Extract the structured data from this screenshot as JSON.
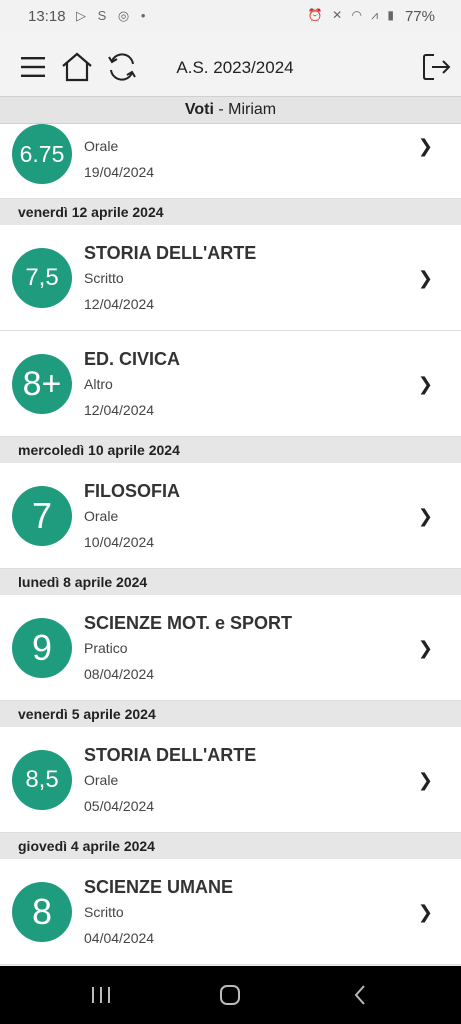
{
  "status_bar": {
    "time": "13:18",
    "battery": "77%",
    "left_icons": [
      "media-icon",
      "s-app-icon",
      "instagram-icon",
      "dot-icon"
    ],
    "right_icons": [
      "alarm-icon",
      "mute-icon",
      "wifi-icon",
      "signal-icon"
    ]
  },
  "top_bar": {
    "title": "A.S. 2023/2024"
  },
  "sub_header": {
    "bold": "Voti",
    "rest": " - Miriam"
  },
  "colors": {
    "accent": "#1f9b7e",
    "header_bg": "#e6e6e6"
  },
  "list": {
    "partial_top": {
      "grade": "6.75",
      "type": "Orale",
      "date": "19/04/2024"
    },
    "groups": [
      {
        "day": "venerdì 12 aprile 2024",
        "items": [
          {
            "grade": "7,5",
            "subject": "STORIA DELL'ARTE",
            "type": "Scritto",
            "date": "12/04/2024"
          },
          {
            "grade": "8+",
            "subject": "ED. CIVICA",
            "type": "Altro",
            "date": "12/04/2024"
          }
        ]
      },
      {
        "day": "mercoledì 10 aprile 2024",
        "items": [
          {
            "grade": "7",
            "subject": "FILOSOFIA",
            "type": "Orale",
            "date": "10/04/2024"
          }
        ]
      },
      {
        "day": "lunedì 8 aprile 2024",
        "items": [
          {
            "grade": "9",
            "subject": "SCIENZE MOT. e SPORT",
            "type": "Pratico",
            "date": "08/04/2024"
          }
        ]
      },
      {
        "day": "venerdì 5 aprile 2024",
        "items": [
          {
            "grade": "8,5",
            "subject": "STORIA DELL'ARTE",
            "type": "Orale",
            "date": "05/04/2024"
          }
        ]
      },
      {
        "day": "giovedì 4 aprile 2024",
        "items": [
          {
            "grade": "8",
            "subject": "SCIENZE UMANE",
            "type": "Scritto",
            "date": "04/04/2024"
          }
        ]
      }
    ],
    "chevron": "❯"
  }
}
